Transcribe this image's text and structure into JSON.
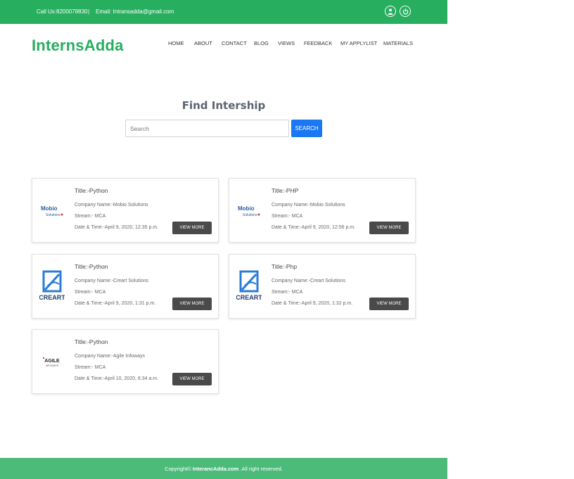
{
  "topbar": {
    "phone": "Call Us:8200078830",
    "separator": "|",
    "email": "Email: Intransadda@gmail.com"
  },
  "header": {
    "brand": "InternsAdda",
    "nav": [
      "HOME",
      "ABOUT",
      "CONTACT",
      "BLOG",
      "VIEWS",
      "FEEDBACK",
      "MY APPLYLIST",
      "MATERIALS"
    ]
  },
  "search": {
    "heading": "Find Intership",
    "placeholder": "Search",
    "button_label": "SEARCH"
  },
  "listings": [
    {
      "title": "Title:-Python",
      "company": "Company Name:-Mobio Solutions",
      "stream": "Stream:- MCA",
      "datetime": "Date & Time:-April 9, 2020, 12:35 p.m.",
      "logo": "mobio-logo",
      "button": "VIEW MORE"
    },
    {
      "title": "Title:-PHP",
      "company": "Company Name:-Mobio Solutions",
      "stream": "Stream:- MCA",
      "datetime": "Date & Time:-April 9, 2020, 12:56 p.m.",
      "logo": "mobio-logo",
      "button": "VIEW MORE"
    },
    {
      "title": "Title:-Python",
      "company": "Company Name:-Creart Solutions",
      "stream": "Stream:- MCA",
      "datetime": "Date & Time:-April 9, 2020, 1:31 p.m.",
      "logo": "creart-logo",
      "button": "VIEW MORE"
    },
    {
      "title": "Title:-Php",
      "company": "Company Name:-Creart Solutions",
      "stream": "Stream:- MCA",
      "datetime": "Date & Time:-April 9, 2020, 1:32 p.m.",
      "logo": "creart-logo",
      "button": "VIEW MORE"
    },
    {
      "title": "Title:-Python",
      "company": "Company Name:-Agile Infoways",
      "stream": "Stream:- MCA",
      "datetime": "Date & Time:-April 10, 2020, 6:34 a.m.",
      "logo": "agile-logo",
      "button": "VIEW MORE"
    }
  ],
  "logos": {
    "mobio": {
      "line1": "Mobio",
      "line2": "Solutions"
    },
    "creart": {
      "text": "CREART"
    },
    "agile": {
      "line1": "AGILE",
      "line2": "INFOWAYS"
    }
  },
  "footer": {
    "prefix": "Copyright© ",
    "site": "InterancAdda.com",
    "suffix": " .All right reserved."
  },
  "colors": {
    "brand_green": "#27ae5f",
    "footer_green": "#4cbb7a",
    "search_blue": "#1a78f2",
    "button_dark": "#4a4a4a"
  }
}
